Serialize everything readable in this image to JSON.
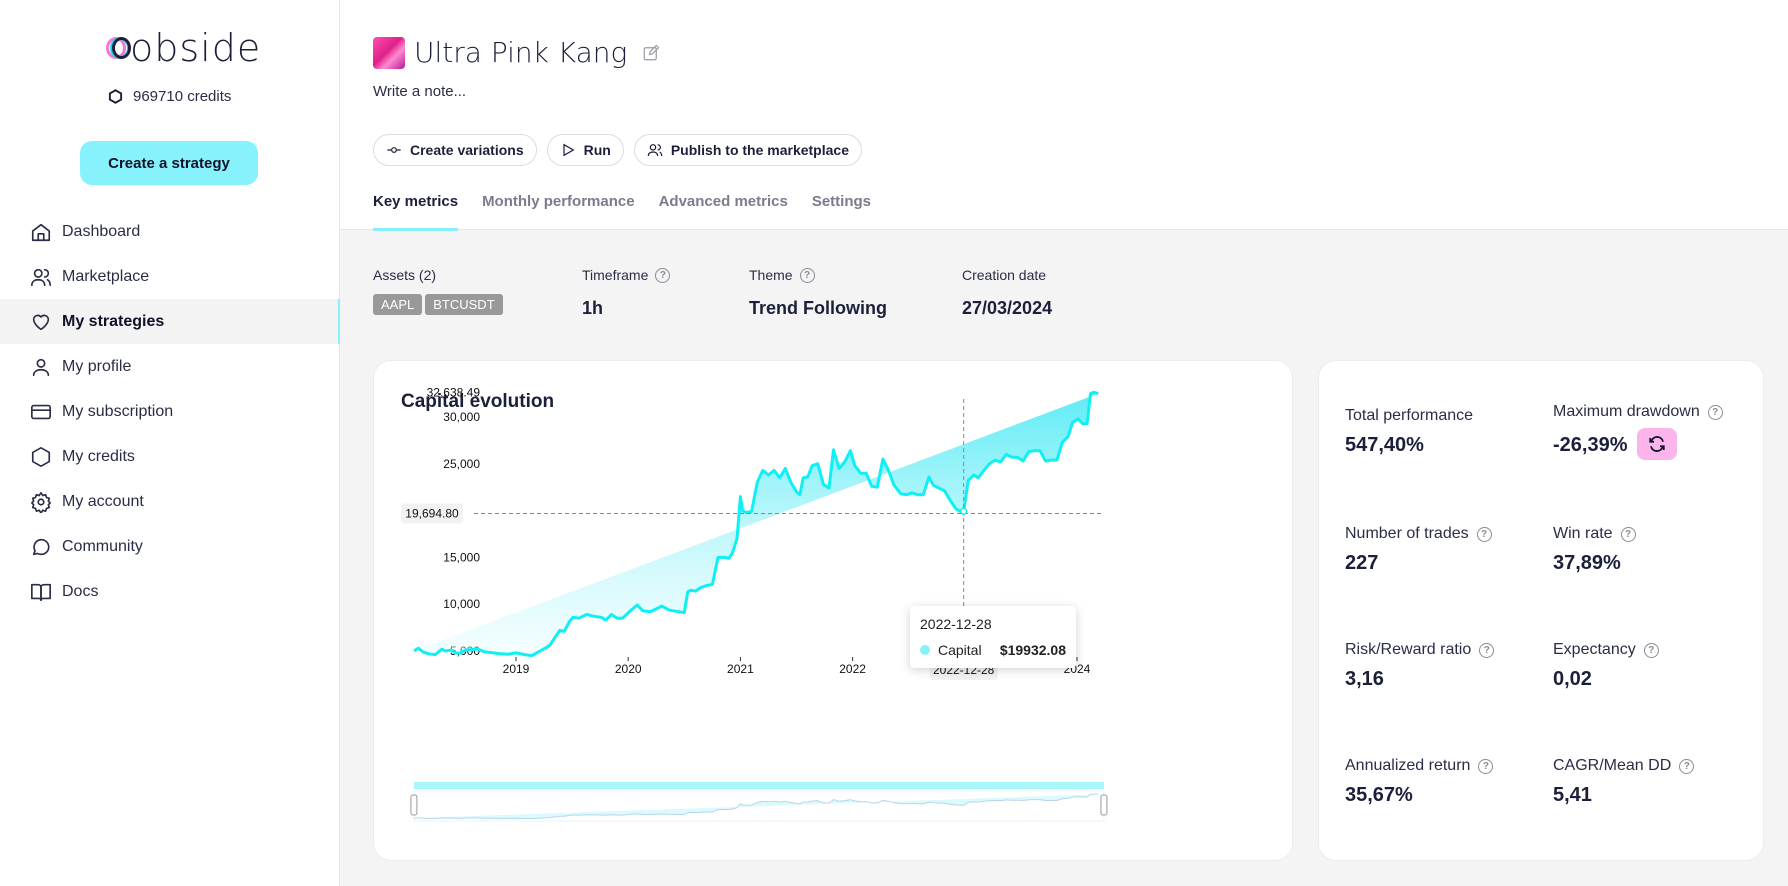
{
  "app": {
    "logo": "obside",
    "credits": "969710 credits",
    "create_label": "Create a strategy"
  },
  "sidebar": {
    "items": [
      {
        "label": "Dashboard",
        "icon": "home-icon"
      },
      {
        "label": "Marketplace",
        "icon": "users-icon"
      },
      {
        "label": "My strategies",
        "icon": "heart-icon",
        "active": true
      },
      {
        "label": "My profile",
        "icon": "user-icon"
      },
      {
        "label": "My subscription",
        "icon": "credit-card-icon"
      },
      {
        "label": "My credits",
        "icon": "hexagon-icon"
      },
      {
        "label": "My account",
        "icon": "gear-icon"
      },
      {
        "label": "Community",
        "icon": "chat-bubble-icon"
      },
      {
        "label": "Docs",
        "icon": "book-icon"
      }
    ]
  },
  "header": {
    "title": "Ultra Pink Kang",
    "note_placeholder": "Write a note...",
    "actions": {
      "variations": "Create variations",
      "run": "Run",
      "publish": "Publish to the marketplace"
    },
    "tabs": [
      "Key metrics",
      "Monthly performance",
      "Advanced metrics",
      "Settings"
    ],
    "active_tab": 0
  },
  "meta": {
    "assets_label": "Assets (2)",
    "assets": [
      "AAPL",
      "BTCUSDT"
    ],
    "timeframe_label": "Timeframe",
    "timeframe": "1h",
    "theme_label": "Theme",
    "theme": "Trend Following",
    "creation_label": "Creation date",
    "creation": "27/03/2024"
  },
  "metrics": {
    "total_performance": {
      "label": "Total performance",
      "value": "547,40%"
    },
    "max_drawdown": {
      "label": "Maximum drawdown",
      "value": "-26,39%"
    },
    "trades": {
      "label": "Number of trades",
      "value": "227"
    },
    "win_rate": {
      "label": "Win rate",
      "value": "37,89%"
    },
    "risk_reward": {
      "label": "Risk/Reward ratio",
      "value": "3,16"
    },
    "expectancy": {
      "label": "Expectancy",
      "value": "0,02"
    },
    "annualized": {
      "label": "Annualized return",
      "value": "35,67%"
    },
    "cagr_dd": {
      "label": "CAGR/Mean DD",
      "value": "5,41"
    }
  },
  "colors": {
    "accent": "#87f2fb",
    "line": "#0ff0f5",
    "pink": "#fbb5ec"
  },
  "tooltip": {
    "date": "2022-12-28",
    "series": "Capital",
    "value": "$19932.08"
  },
  "chart_data": {
    "type": "area",
    "title": "Capital evolution",
    "xlabel": "",
    "ylabel": "",
    "ylim": [
      4200,
      32638.49
    ],
    "xlim": [
      2018.09,
      2024.24
    ],
    "y_ticks": [
      5000,
      10000,
      15000,
      20000,
      25000,
      30000
    ],
    "y_tick_labels": [
      "5,000",
      "10,000",
      "15,000",
      "",
      "25,000",
      "30,000"
    ],
    "y_max_label": "32,638.49",
    "x_ticks": [
      2019,
      2020,
      2021,
      2022,
      2024
    ],
    "x_tick_labels": [
      "2019",
      "2020",
      "2021",
      "2022",
      "2024"
    ],
    "crosshair": {
      "x": 2022.99,
      "x_label": "2022-12-28",
      "y": 19694.8,
      "y_label": "19,694.80"
    },
    "legend": "none",
    "series": [
      {
        "name": "Capital",
        "x": [
          2018.09,
          2018.13,
          2018.17,
          2018.22,
          2018.28,
          2018.34,
          2018.37,
          2018.42,
          2018.46,
          2018.5,
          2018.55,
          2018.6,
          2018.66,
          2018.72,
          2018.8,
          2018.86,
          2018.93,
          2019.0,
          2019.08,
          2019.14,
          2019.2,
          2019.26,
          2019.3,
          2019.35,
          2019.39,
          2019.43,
          2019.48,
          2019.51,
          2019.56,
          2019.63,
          2019.7,
          2019.76,
          2019.8,
          2019.85,
          2019.9,
          2019.95,
          2020.02,
          2020.08,
          2020.13,
          2020.2,
          2020.25,
          2020.3,
          2020.36,
          2020.4,
          2020.45,
          2020.5,
          2020.53,
          2020.56,
          2020.6,
          2020.65,
          2020.7,
          2020.75,
          2020.8,
          2020.86,
          2020.9,
          2020.93,
          2020.97,
          2021.0,
          2021.02,
          2021.05,
          2021.1,
          2021.15,
          2021.2,
          2021.25,
          2021.3,
          2021.35,
          2021.4,
          2021.45,
          2021.5,
          2021.53,
          2021.56,
          2021.6,
          2021.64,
          2021.69,
          2021.74,
          2021.79,
          2021.83,
          2021.88,
          2021.93,
          2021.98,
          2022.02,
          2022.07,
          2022.12,
          2022.17,
          2022.22,
          2022.27,
          2022.32,
          2022.37,
          2022.43,
          2022.48,
          2022.53,
          2022.58,
          2022.63,
          2022.68,
          2022.72,
          2022.77,
          2022.82,
          2022.87,
          2022.92,
          2022.96,
          2022.99,
          2023.03,
          2023.08,
          2023.12,
          2023.17,
          2023.22,
          2023.27,
          2023.32,
          2023.37,
          2023.42,
          2023.47,
          2023.52,
          2023.57,
          2023.62,
          2023.67,
          2023.72,
          2023.77,
          2023.82,
          2023.87,
          2023.92,
          2023.96,
          2024.01,
          2024.05,
          2024.09,
          2024.12,
          2024.15,
          2024.19,
          2024.24
        ],
        "y": [
          5000,
          5300,
          4900,
          4700,
          4600,
          5200,
          5000,
          5100,
          4800,
          4750,
          5100,
          5150,
          5200,
          4900,
          4800,
          4700,
          4650,
          4800,
          4600,
          4500,
          4900,
          5300,
          5600,
          6500,
          7200,
          7100,
          8200,
          8600,
          8500,
          8900,
          8700,
          8600,
          8300,
          8900,
          8500,
          8500,
          9300,
          9900,
          9300,
          9200,
          9500,
          9800,
          9400,
          9300,
          9200,
          9100,
          11300,
          11500,
          11400,
          11800,
          12000,
          12100,
          15000,
          15000,
          14900,
          15500,
          17000,
          21500,
          20000,
          19800,
          19900,
          23000,
          24300,
          23800,
          24300,
          23500,
          24500,
          23000,
          22000,
          21700,
          23500,
          23600,
          24800,
          25000,
          22800,
          22400,
          26500,
          24500,
          25200,
          26400,
          24800,
          24000,
          24000,
          22600,
          22500,
          25500,
          24300,
          22700,
          21800,
          21700,
          21900,
          21700,
          21700,
          23600,
          22700,
          22400,
          22100,
          21100,
          20200,
          19900,
          19932.08,
          23200,
          23800,
          23500,
          24300,
          25000,
          25400,
          25200,
          26000,
          25700,
          25700,
          25300,
          26300,
          26400,
          26400,
          25300,
          25400,
          25400,
          27300,
          27900,
          29400,
          29800,
          29300,
          29300,
          32500,
          32638.49,
          32500
        ]
      }
    ]
  }
}
